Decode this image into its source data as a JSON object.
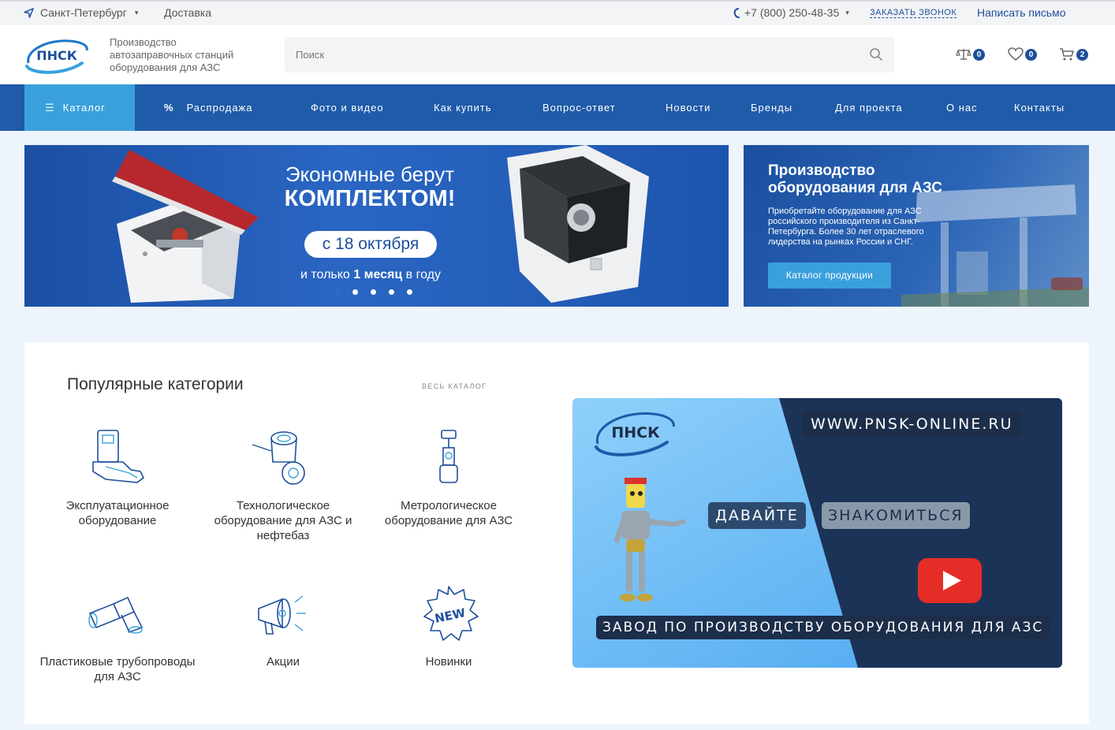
{
  "topbar": {
    "city": "Санкт-Петербург",
    "delivery": "Доставка",
    "phone": "+7 (800) 250-48-35",
    "callback": "ЗАКАЗАТЬ ЗВОНОК",
    "write": "Написать письмо"
  },
  "header": {
    "logo_text": "ПНСК",
    "tagline_1": "Производство",
    "tagline_2": "автозаправочных станций",
    "tagline_3": "оборудования для АЗС",
    "search_placeholder": "Поиск",
    "compare_count": "0",
    "favorites_count": "0",
    "cart_count": "2"
  },
  "nav": {
    "catalog": "Каталог",
    "items": [
      "Распродажа",
      "Фото и видео",
      "Как купить",
      "Вопрос-ответ",
      "Новости",
      "Бренды",
      "Для проекта",
      "О нас",
      "Контакты"
    ],
    "sale_icon": "%"
  },
  "hero": {
    "line1": "Экономные берут",
    "line2": "КОМПЛЕКТОМ!",
    "pill": "с 18 октября",
    "sub_a": "и только ",
    "sub_b": "1 месяц",
    "sub_c": " в году",
    "slides_total": 5,
    "active_slide": 1
  },
  "promo": {
    "title": "Производство оборудования для АЗС",
    "text": "Приобретайте оборудование для АЗС российского производителя из Санкт-Петербурга. Более 30 лет отраслевого лидерства на рынках России и СНГ.",
    "button": "Каталог продукции"
  },
  "categories": {
    "title": "Популярные категории",
    "all_link": "ВЕСЬ КАТАЛОГ",
    "items": [
      {
        "label": "Эксплуатационное оборудование",
        "icon": "tank-cover-icon"
      },
      {
        "label": "Технологическое оборудование для АЗС и нефтебаз",
        "icon": "valve-icon"
      },
      {
        "label": "Метрологическое оборудование для АЗС",
        "icon": "meter-icon"
      },
      {
        "label": "Пластиковые трубопроводы для АЗС",
        "icon": "pipe-icon"
      },
      {
        "label": "Акции",
        "icon": "megaphone-icon"
      },
      {
        "label": "Новинки",
        "icon": "new-badge-icon"
      }
    ]
  },
  "video": {
    "logo": "ПНСК",
    "site": "WWW.PNSK-ONLINE.RU",
    "word1": "ДАВАЙТЕ",
    "word2": "ЗНАКОМИТЬСЯ",
    "caption": "ЗАВОД ПО ПРОИЗВОДСТВУ ОБОРУДОВАНИЯ ДЛЯ АЗС"
  },
  "colors": {
    "brand": "#1f5ba8",
    "accent": "#3aa0dc",
    "dark_navy": "#1c2e4a",
    "youtube_red": "#e52d27"
  }
}
